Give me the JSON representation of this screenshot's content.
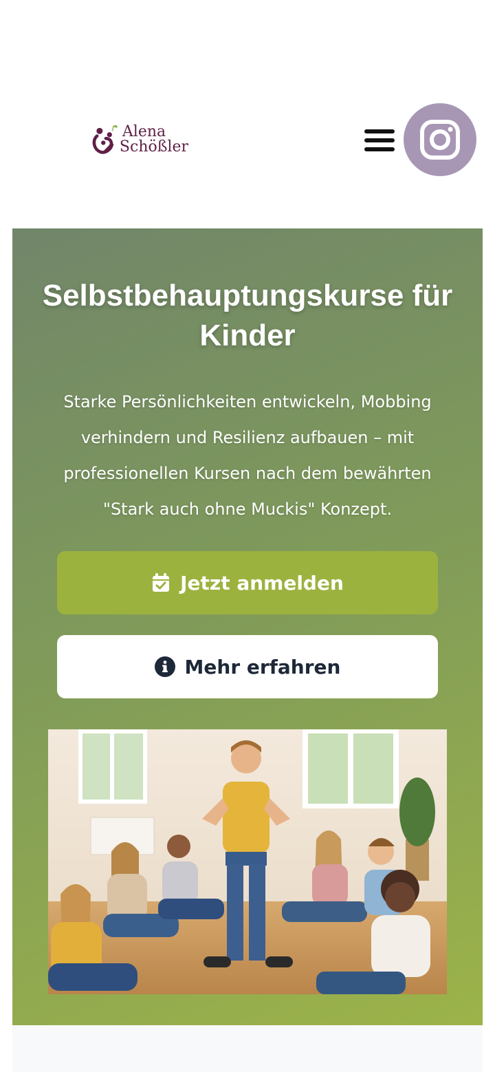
{
  "header": {
    "logo": {
      "line1": "Alena",
      "line2": "Schößler"
    },
    "menu_icon": "hamburger-menu-icon",
    "social_icon": "instagram-icon"
  },
  "hero": {
    "title": "Selbstbehauptungskurse für Kinder",
    "subtitle": "Starke Persönlichkeiten entwickeln, Mobbing verhindern und Resilienz aufbauen – mit professionellen Kursen nach dem bewährten \"Stark auch ohne Muckis\" Konzept.",
    "primary_button": {
      "label": "Jetzt anmelden",
      "icon": "calendar-check-icon"
    },
    "secondary_button": {
      "label": "Mehr erfahren",
      "icon": "info-circle-icon"
    }
  },
  "colors": {
    "brand": "#5f1f47",
    "accent": "#9cb23f",
    "instagram_bg": "#a797b5",
    "hero_gradient_start": "#71866a",
    "hero_gradient_end": "#9cb349"
  }
}
